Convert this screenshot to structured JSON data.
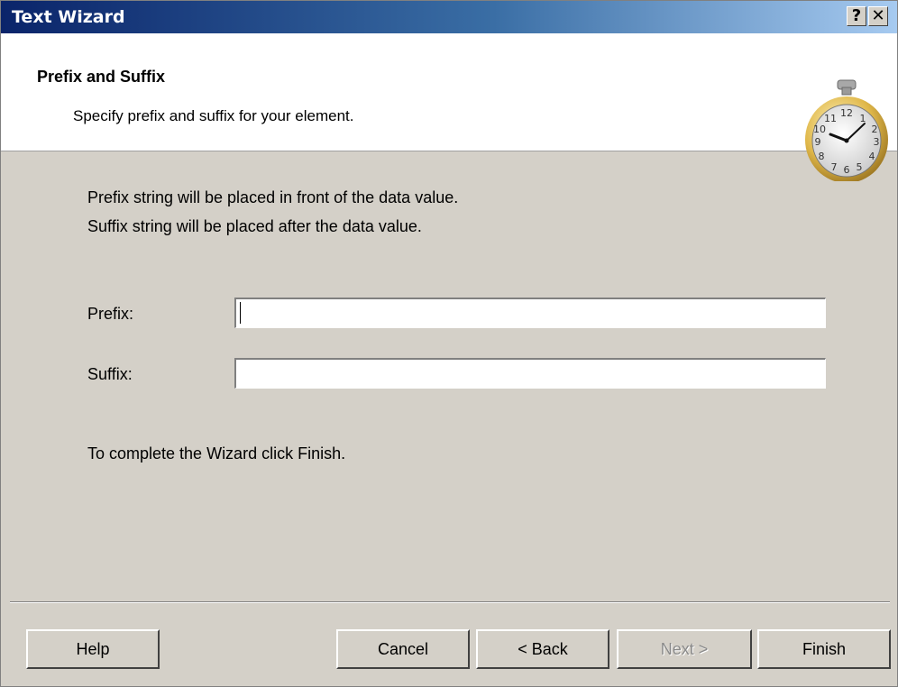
{
  "window": {
    "title": "Text Wizard",
    "help_button": "?",
    "close_button": "✕"
  },
  "header": {
    "title": "Prefix and Suffix",
    "subtitle": "Specify prefix and suffix for your element."
  },
  "body": {
    "line1": "Prefix string will be placed in front of the data value.",
    "line2": "Suffix string will be placed after the data value.",
    "prefix_label": "Prefix:",
    "prefix_value": "",
    "suffix_label": "Suffix:",
    "suffix_value": "",
    "finish_hint": "To complete the Wizard click Finish."
  },
  "buttons": {
    "help": "Help",
    "cancel": "Cancel",
    "back": "< Back",
    "next": "Next >",
    "finish": "Finish"
  },
  "colors": {
    "title_gradient_start": "#0a246a",
    "title_gradient_end": "#a6caf0",
    "dialog_face": "#d4d0c8"
  },
  "icons": {
    "header_graphic": "stopwatch-icon"
  }
}
